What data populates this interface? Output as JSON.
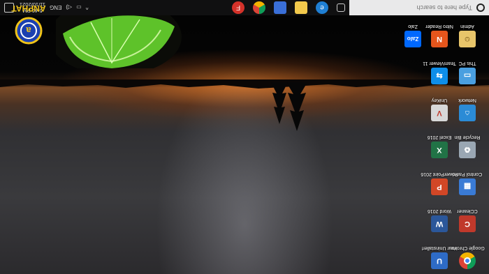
{
  "taskbar": {
    "search_placeholder": "Type here to search",
    "pinned": [
      {
        "name": "task-view-icon"
      },
      {
        "name": "edge-icon",
        "color": "#1f7fd3"
      },
      {
        "name": "file-explorer-icon",
        "color": "#f2c94c"
      },
      {
        "name": "store-icon",
        "color": "#3a6fd8"
      },
      {
        "name": "chrome-icon",
        "color": "#2f9a47"
      },
      {
        "name": "foxit-icon",
        "color": "#d4322a"
      }
    ],
    "tray": {
      "language": "ENG",
      "time": "5:46 PM",
      "date": "11/10/2021"
    }
  },
  "desktop_icons": {
    "col1": [
      {
        "label": "Google Chrome",
        "icon": "chrome-icon",
        "color": "#2f9a47"
      },
      {
        "label": "CCleaner",
        "icon": "ccleaner-icon",
        "color": "#c0392b"
      },
      {
        "label": "Control Panel",
        "icon": "control-panel-icon",
        "color": "#3a7bd5"
      },
      {
        "label": "Recycle Bin",
        "icon": "recycle-bin-icon",
        "color": "#9aa7b3"
      },
      {
        "label": "Network",
        "icon": "network-icon",
        "color": "#2b8bd6"
      },
      {
        "label": "This PC",
        "icon": "this-pc-icon",
        "color": "#4a9fe0"
      },
      {
        "label": "Admin",
        "icon": "user-folder-icon",
        "color": "#e8c56a"
      }
    ],
    "col2": [
      {
        "label": "Your Uninstaller!",
        "icon": "uninstaller-icon",
        "color": "#2e6bc6"
      },
      {
        "label": "Word 2016",
        "icon": "word-icon",
        "color": "#2b579a"
      },
      {
        "label": "PowerPoint 2016",
        "icon": "powerpoint-icon",
        "color": "#d24726"
      },
      {
        "label": "Excel 2016",
        "icon": "excel-icon",
        "color": "#217346"
      },
      {
        "label": "UniKey",
        "icon": "unikey-icon",
        "color": "#d8d8d8"
      },
      {
        "label": "TeamViewer 11",
        "icon": "teamviewer-icon",
        "color": "#0e8ee9"
      },
      {
        "label": "Nitro Reader",
        "icon": "nitro-icon",
        "color": "#e5551c"
      }
    ],
    "col3": [
      {
        "label": "Zalo",
        "icon": "zalo-icon",
        "color": "#0068ff"
      }
    ]
  },
  "watermark": {
    "text": "ANPHAT",
    "color": "#f0c419"
  }
}
